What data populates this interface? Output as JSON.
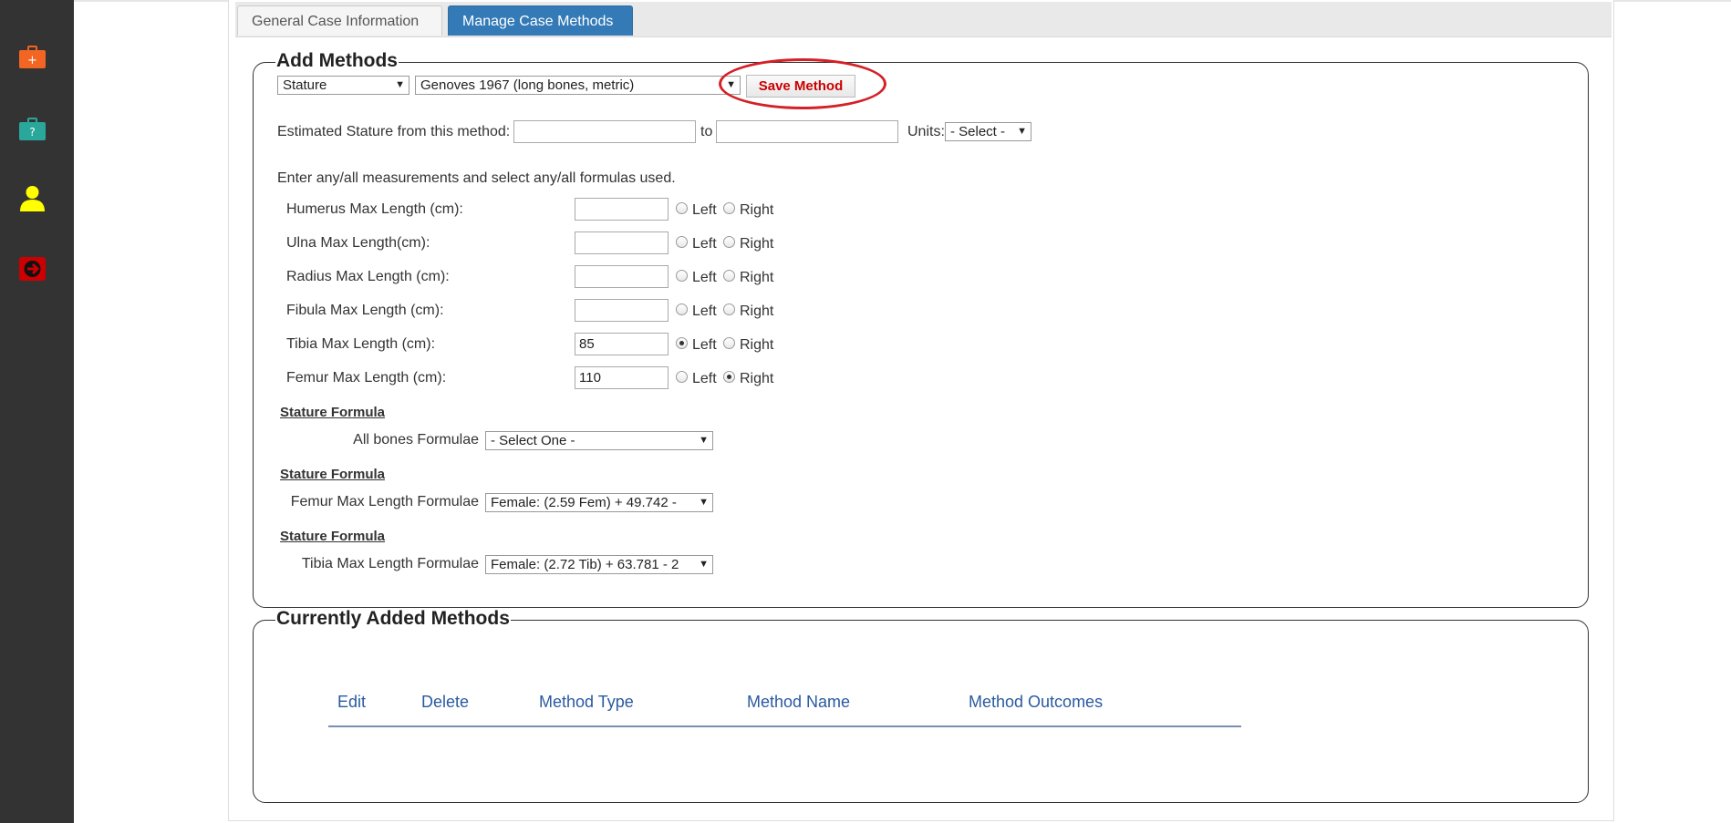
{
  "sidebar": {
    "items": [
      {
        "icon": "briefcase-plus-icon",
        "color": "#f26522"
      },
      {
        "icon": "briefcase-question-icon",
        "color": "#2aa79b"
      },
      {
        "icon": "user-icon",
        "color": "#ffff00"
      },
      {
        "icon": "logout-icon",
        "color": "#cc0000"
      }
    ]
  },
  "tabs": [
    {
      "label": "General Case Information",
      "active": false
    },
    {
      "label": "Manage Case Methods",
      "active": true
    }
  ],
  "add_methods": {
    "legend": "Add Methods",
    "category_select": "Stature",
    "method_select": "Genoves 1967 (long bones, metric)",
    "save_label": "Save Method",
    "estimate_label": "Estimated Stature from this method:",
    "estimate_from": "",
    "to_label": "to",
    "estimate_to": "",
    "units_label": "Units:",
    "units_select": "- Select -",
    "instructions": "Enter any/all measurements and select any/all formulas used.",
    "left_label": "Left",
    "right_label": "Right",
    "measurements": [
      {
        "label": "Humerus Max Length (cm):",
        "value": "",
        "side": ""
      },
      {
        "label": "Ulna Max Length(cm):",
        "value": "",
        "side": ""
      },
      {
        "label": "Radius Max Length (cm):",
        "value": "",
        "side": ""
      },
      {
        "label": "Fibula Max Length (cm):",
        "value": "",
        "side": ""
      },
      {
        "label": "Tibia Max Length (cm):",
        "value": "85",
        "side": "left"
      },
      {
        "label": "Femur Max Length (cm):",
        "value": "110",
        "side": "right"
      }
    ],
    "formulas": [
      {
        "heading": "Stature Formula",
        "label": "All bones Formulae",
        "selected": "- Select One -"
      },
      {
        "heading": "Stature Formula",
        "label": "Femur Max Length Formulae",
        "selected": "Female: (2.59 Fem) + 49.742 -"
      },
      {
        "heading": "Stature Formula",
        "label": "Tibia Max Length Formulae",
        "selected": "Female: (2.72 Tib) + 63.781 - 2"
      }
    ]
  },
  "current_methods": {
    "legend": "Currently Added Methods",
    "columns": [
      "Edit",
      "Delete",
      "Method Type",
      "Method Name",
      "Method Outcomes"
    ]
  },
  "colors": {
    "accent": "#337ab7",
    "save_text": "#cc0000",
    "highlight_ellipse": "#d42026",
    "table_header": "#2a5aa0"
  }
}
